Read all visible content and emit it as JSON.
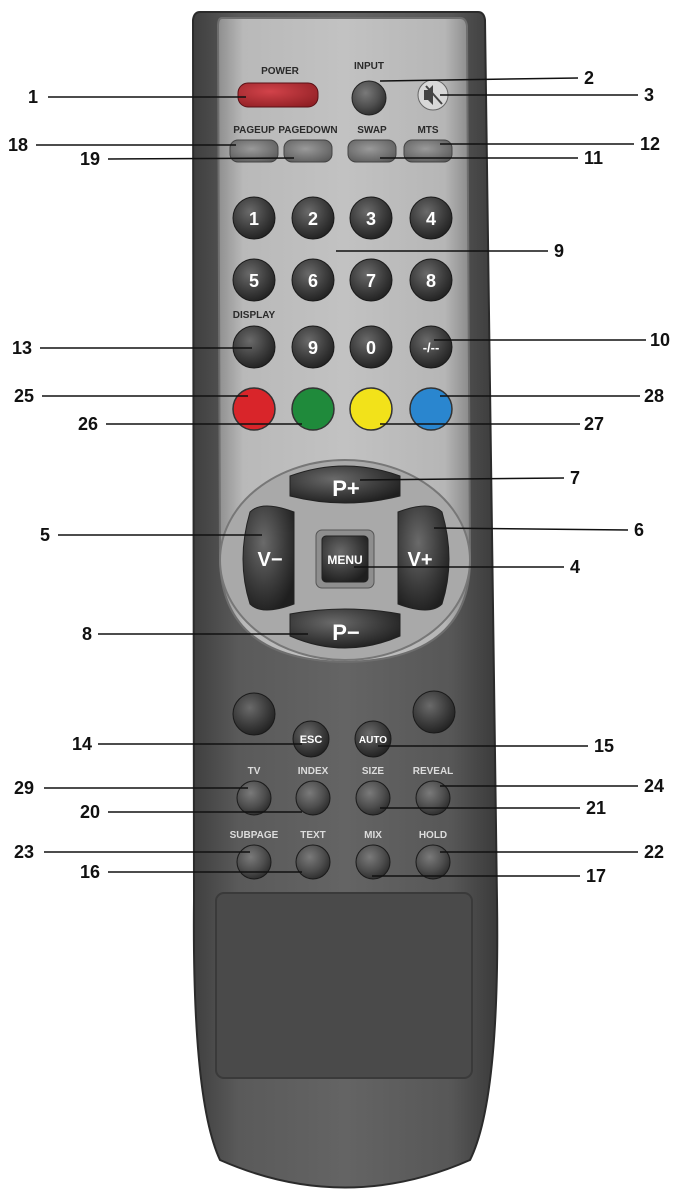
{
  "buttons": {
    "power": "POWER",
    "input": "INPUT",
    "pageup": "PAGEUP",
    "pagedown": "PAGEDOWN",
    "swap": "SWAP",
    "mts": "MTS",
    "digits": [
      "1",
      "2",
      "3",
      "4",
      "5",
      "6",
      "7",
      "8",
      "9",
      "0"
    ],
    "display": "DISPLAY",
    "dash": "-/--",
    "p_plus": "P+",
    "p_minus": "P−",
    "v_minus": "V−",
    "v_plus": "V+",
    "menu": "MENU",
    "esc": "ESC",
    "auto": "AUTO",
    "tv": "TV",
    "index": "INDEX",
    "size": "SIZE",
    "reveal": "REVEAL",
    "subpage": "SUBPAGE",
    "text": "TEXT",
    "mix": "MIX",
    "hold": "HOLD"
  },
  "mute_icon": "mute-speaker-icon",
  "color_keys": [
    "#d9252a",
    "#1f8a3b",
    "#f2e21a",
    "#2a86cf"
  ],
  "callouts": {
    "c1": "1",
    "c2": "2",
    "c3": "3",
    "c4": "4",
    "c5": "5",
    "c6": "6",
    "c7": "7",
    "c8": "8",
    "c9": "9",
    "c10": "10",
    "c11": "11",
    "c12": "12",
    "c13": "13",
    "c14": "14",
    "c15": "15",
    "c16": "16",
    "c17": "17",
    "c18": "18",
    "c19": "19",
    "c20": "20",
    "c21": "21",
    "c22": "22",
    "c23": "23",
    "c24": "24",
    "c25": "25",
    "c26": "26",
    "c27": "27",
    "c28": "28",
    "c29": "29"
  }
}
